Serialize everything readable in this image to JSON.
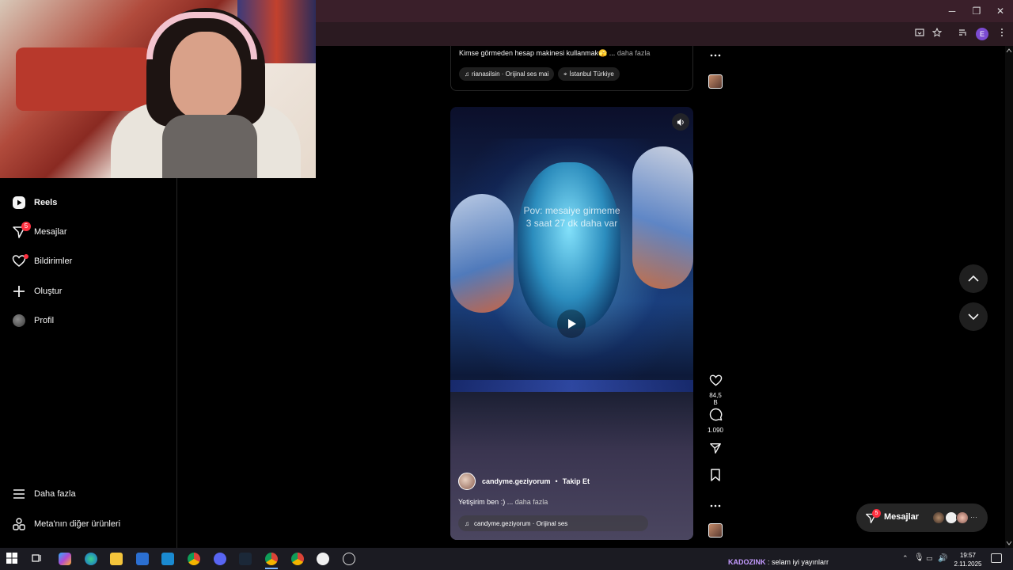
{
  "browser": {
    "window_controls": {
      "minimize": "─",
      "restore": "❐",
      "close": "✕"
    },
    "profile_initial": "E"
  },
  "sidebar": {
    "items": [
      {
        "label": "Reels",
        "icon": "reels-icon",
        "bold": true
      },
      {
        "label": "Mesajlar",
        "icon": "messenger-icon",
        "badge": "5"
      },
      {
        "label": "Bildirimler",
        "icon": "heart-icon",
        "dot": true
      },
      {
        "label": "Oluştur",
        "icon": "plus-icon"
      },
      {
        "label": "Profil",
        "icon": "avatar-icon"
      }
    ],
    "bottom_items": [
      {
        "label": "Daha fazla",
        "icon": "menu-icon"
      },
      {
        "label": "Meta'nın diğer ürünleri",
        "icon": "meta-apps-icon"
      }
    ]
  },
  "top_post": {
    "caption": "Kimse görmeden hesap makinesi kullanmak🫣 ...",
    "more": "daha fazla",
    "audio_chip": "rianasilsin · Orijinal ses   mai",
    "location_chip": "İstanbul Türkiye"
  },
  "reel": {
    "overlay_line1": "Pov: mesaiye girmeme",
    "overlay_line2": "3 saat 27 dk daha var",
    "username": "candyme.geziyorum",
    "separator": "•",
    "follow_label": "Takip Et",
    "caption": "Yetişirim ben :) ...",
    "more": "daha fazla",
    "audio": "candyme.geziyorum · Orijinal ses"
  },
  "actions": {
    "likes": "84,5 B",
    "comments": "1.090"
  },
  "messages_pill": {
    "label": "Mesajlar",
    "badge": "5"
  },
  "taskbar": {
    "chat_user": "KADOZINK",
    "chat_message": ": selam iyi yayınlarr",
    "time": "19:57",
    "date": "2.11.2025"
  },
  "colors": {
    "titlebar": "#3a1f2a",
    "notification_red": "#ff3040",
    "background": "#000000"
  }
}
